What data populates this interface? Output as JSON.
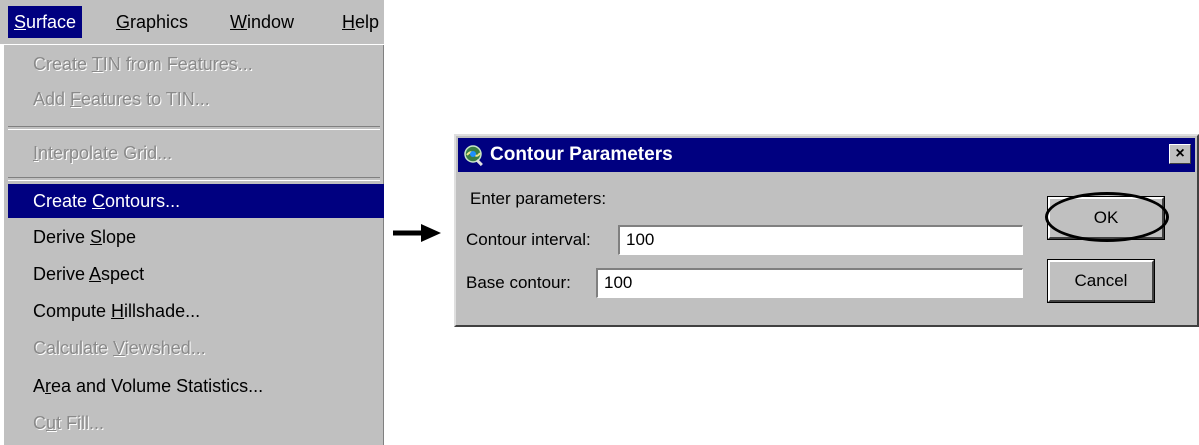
{
  "menubar": {
    "items": [
      {
        "pre": "",
        "key": "S",
        "post": "urface",
        "active": true
      },
      {
        "pre": "",
        "key": "G",
        "post": "raphics",
        "active": false
      },
      {
        "pre": "",
        "key": "W",
        "post": "indow",
        "active": false
      },
      {
        "pre": "",
        "key": "H",
        "post": "elp",
        "active": false
      }
    ]
  },
  "surface_menu": {
    "items": [
      {
        "pre": "Create ",
        "key": "T",
        "post": "IN from Features...",
        "state": "disabled"
      },
      {
        "pre": "Add ",
        "key": "F",
        "post": "eatures to TIN...",
        "state": "disabled"
      },
      {
        "pre": "",
        "key": "I",
        "post": "nterpolate Grid...",
        "state": "disabled"
      },
      {
        "pre": "Create ",
        "key": "C",
        "post": "ontours...",
        "state": "highlighted"
      },
      {
        "pre": "Derive ",
        "key": "S",
        "post": "lope",
        "state": "enabled"
      },
      {
        "pre": "Derive ",
        "key": "A",
        "post": "spect",
        "state": "enabled"
      },
      {
        "pre": "Compute ",
        "key": "H",
        "post": "illshade...",
        "state": "enabled"
      },
      {
        "pre": "Calculate ",
        "key": "V",
        "post": "iewshed...",
        "state": "disabled"
      },
      {
        "pre": "A",
        "key": "r",
        "post": "ea and Volume Statistics...",
        "state": "enabled"
      },
      {
        "pre": "C",
        "key": "u",
        "post": "t Fill...",
        "state": "disabled"
      }
    ]
  },
  "dialog": {
    "title": "Contour Parameters",
    "close_label": "×",
    "prompt": "Enter parameters:",
    "fields": [
      {
        "label": "Contour interval:",
        "value": "100"
      },
      {
        "label": "Base contour:",
        "value": "100"
      }
    ],
    "ok_label": "OK",
    "cancel_label": "Cancel"
  },
  "colors": {
    "menu_face": "#c0c0c0",
    "highlight": "#000080",
    "disabled_text": "#8a8a8a"
  },
  "icons": [
    "surface-analyst-icon",
    "close-icon",
    "right-arrow-icon"
  ]
}
